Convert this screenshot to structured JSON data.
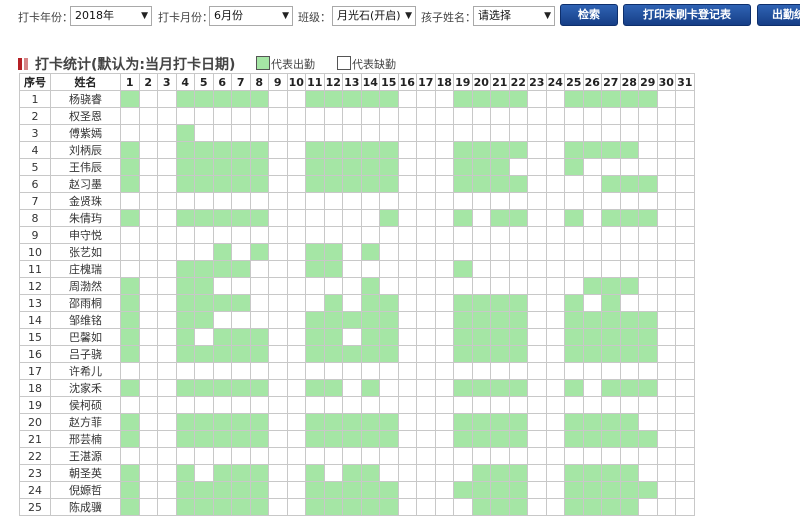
{
  "filters": {
    "year_label": "打卡年份：",
    "year_value": "2018年",
    "month_label": "打卡月份：",
    "month_value": "6月份",
    "class_label": "班级：",
    "class_value": "月光石(开启)",
    "child_label": "孩子姓名：",
    "child_value": "请选择"
  },
  "buttons": {
    "search": "检索",
    "print": "打印未刷卡登记表",
    "attendance": "出勤统计"
  },
  "section": {
    "title": "打卡统计(默认为:当月打卡日期)",
    "legend_present": "代表出勤",
    "legend_absent": "代表缺勤"
  },
  "colors": {
    "present": "#a5e6a5",
    "button": "#1e4c9a",
    "title_marker": "#b52025"
  },
  "table": {
    "col_index": "序号",
    "col_name": "姓名",
    "days": [
      "1",
      "2",
      "3",
      "4",
      "5",
      "6",
      "7",
      "8",
      "9",
      "10",
      "11",
      "12",
      "13",
      "14",
      "15",
      "16",
      "17",
      "18",
      "19",
      "20",
      "21",
      "22",
      "23",
      "24",
      "25",
      "26",
      "27",
      "28",
      "29",
      "30",
      "31"
    ],
    "rows": [
      {
        "no": "1",
        "name": "杨骁睿",
        "present": [
          1,
          4,
          5,
          6,
          7,
          8,
          11,
          12,
          13,
          14,
          15,
          19,
          20,
          21,
          22,
          25,
          26,
          27,
          28,
          29
        ]
      },
      {
        "no": "2",
        "name": "权圣恩",
        "present": []
      },
      {
        "no": "3",
        "name": "傅紫嫣",
        "present": [
          4
        ]
      },
      {
        "no": "4",
        "name": "刘柄辰",
        "present": [
          1,
          4,
          5,
          6,
          7,
          8,
          11,
          12,
          13,
          14,
          15,
          19,
          20,
          21,
          22,
          25,
          26,
          27,
          28
        ]
      },
      {
        "no": "5",
        "name": "王伟辰",
        "present": [
          1,
          4,
          5,
          6,
          7,
          8,
          11,
          12,
          13,
          14,
          15,
          19,
          20,
          21,
          25
        ]
      },
      {
        "no": "6",
        "name": "赵习墨",
        "present": [
          1,
          4,
          5,
          6,
          7,
          8,
          11,
          12,
          13,
          14,
          15,
          19,
          20,
          21,
          22,
          27,
          28,
          29
        ]
      },
      {
        "no": "7",
        "name": "金贤珠",
        "present": []
      },
      {
        "no": "8",
        "name": "朱倩玙",
        "present": [
          1,
          4,
          5,
          6,
          7,
          8,
          15,
          19,
          21,
          22,
          25,
          27,
          28,
          29
        ]
      },
      {
        "no": "9",
        "name": "申守悦",
        "present": []
      },
      {
        "no": "10",
        "name": "张艺如",
        "present": [
          6,
          8,
          11,
          12,
          14
        ]
      },
      {
        "no": "11",
        "name": "庄槐瑞",
        "present": [
          4,
          5,
          6,
          7,
          11,
          12,
          19
        ]
      },
      {
        "no": "12",
        "name": "周渤然",
        "present": [
          1,
          4,
          5,
          14,
          26,
          27,
          28
        ]
      },
      {
        "no": "13",
        "name": "邵雨桐",
        "present": [
          1,
          4,
          5,
          6,
          7,
          12,
          14,
          15,
          19,
          20,
          21,
          22,
          25,
          27
        ]
      },
      {
        "no": "14",
        "name": "邹维铭",
        "present": [
          1,
          4,
          5,
          11,
          12,
          13,
          14,
          15,
          19,
          20,
          21,
          22,
          25,
          26,
          27,
          28,
          29
        ]
      },
      {
        "no": "15",
        "name": "巴馨如",
        "present": [
          1,
          4,
          6,
          7,
          8,
          11,
          12,
          14,
          15,
          19,
          20,
          21,
          22,
          25,
          26,
          27,
          28,
          29
        ]
      },
      {
        "no": "16",
        "name": "吕子骁",
        "present": [
          1,
          4,
          5,
          6,
          7,
          8,
          11,
          12,
          13,
          14,
          15,
          19,
          20,
          21,
          22,
          25,
          26,
          27,
          28,
          29
        ]
      },
      {
        "no": "17",
        "name": "许希儿",
        "present": []
      },
      {
        "no": "18",
        "name": "沈家禾",
        "present": [
          1,
          4,
          5,
          6,
          7,
          8,
          11,
          12,
          14,
          19,
          20,
          21,
          22,
          25,
          27,
          28,
          29
        ]
      },
      {
        "no": "19",
        "name": "侯柯硕",
        "present": []
      },
      {
        "no": "20",
        "name": "赵方菲",
        "present": [
          1,
          4,
          5,
          6,
          7,
          8,
          11,
          12,
          13,
          14,
          15,
          19,
          20,
          21,
          22,
          25,
          26,
          27,
          28
        ]
      },
      {
        "no": "21",
        "name": "邢芸楠",
        "present": [
          1,
          4,
          5,
          6,
          7,
          8,
          11,
          12,
          13,
          14,
          15,
          19,
          20,
          21,
          22,
          25,
          26,
          27,
          28,
          29
        ]
      },
      {
        "no": "22",
        "name": "王湛源",
        "present": []
      },
      {
        "no": "23",
        "name": "朝圣英",
        "present": [
          1,
          4,
          6,
          7,
          8,
          11,
          13,
          14,
          20,
          21,
          22,
          25,
          26,
          27,
          28
        ]
      },
      {
        "no": "24",
        "name": "倪嫄哲",
        "present": [
          1,
          4,
          5,
          6,
          7,
          8,
          11,
          12,
          13,
          14,
          15,
          19,
          20,
          21,
          22,
          25,
          26,
          27,
          28,
          29
        ]
      },
      {
        "no": "25",
        "name": "陈成骥",
        "present": [
          1,
          4,
          5,
          6,
          7,
          8,
          11,
          12,
          13,
          14,
          15,
          20,
          21,
          22,
          25,
          26,
          27,
          28
        ]
      }
    ]
  }
}
